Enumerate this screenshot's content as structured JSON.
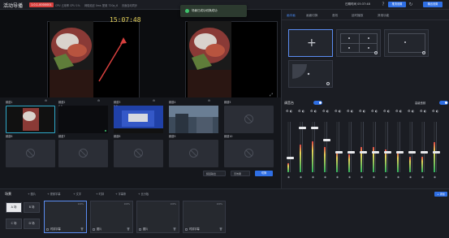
{
  "topbar": {
    "app_title": "活动导播",
    "version": "1.0.1-0000001",
    "cpu": "CPU 占用率 CPU 1%",
    "net": "网络延迟 0ms",
    "res": "配置 720p_6",
    "sync": "页面自动同步",
    "clock": "日期时间 05:37:48",
    "settings_btn": "推流设置",
    "output_btn": "输出设置"
  },
  "toast": {
    "text": "场景已成功切换成功"
  },
  "preview": {
    "clock": "15:07:48",
    "pvw_label": "PVW 预监",
    "pgm_label": "PGM 输出",
    "accent_pvw": "#4a8cf7",
    "accent_pgm": "#e04646"
  },
  "sources": {
    "items": [
      {
        "label": "频道1",
        "meta": "1 ✕",
        "status": "live"
      },
      {
        "label": "频道2",
        "meta": "2 ✕",
        "status": "live"
      },
      {
        "label": "频道3",
        "meta": "3 ✕",
        "status": "live"
      },
      {
        "label": "频道4",
        "meta": "4 ✕",
        "status": "live"
      },
      {
        "label": "频道5",
        "meta": "",
        "status": "empty"
      },
      {
        "label": "频道6",
        "meta": "",
        "status": "empty"
      },
      {
        "label": "频道7",
        "meta": "",
        "status": "empty"
      },
      {
        "label": "频道8",
        "meta": "",
        "status": "empty"
      },
      {
        "label": "频道9",
        "meta": "",
        "status": "empty"
      },
      {
        "label": "频道10",
        "meta": "",
        "status": "empty"
      }
    ],
    "select_a": "频道输出",
    "select_b": "无效果",
    "switch_btn": "切换"
  },
  "right_panel": {
    "tabs": [
      "画中画",
      "画面切换",
      "音效",
      "延时播放",
      "其他功能"
    ]
  },
  "mixer": {
    "title": "调音台",
    "right_label": "高级音频",
    "channels": [
      {
        "level": 0.18,
        "knob": 0.72
      },
      {
        "level": 0.55,
        "knob": 0.1
      },
      {
        "level": 0.62,
        "knob": 0.1
      },
      {
        "level": 0.5,
        "knob": 0.35
      },
      {
        "level": 0.4,
        "knob": 0.6
      },
      {
        "level": 0.35,
        "knob": 0.6
      },
      {
        "level": 0.5,
        "knob": 0.6
      },
      {
        "level": 0.5,
        "knob": 0.6
      },
      {
        "level": 0.45,
        "knob": 0.6
      },
      {
        "level": 0.4,
        "knob": 0.6
      },
      {
        "level": 0.3,
        "knob": 0.6
      },
      {
        "level": 0.3,
        "knob": 0.6
      },
      {
        "level": 0.6,
        "knob": 0.6
      }
    ]
  },
  "scene": {
    "title": "场景",
    "toolbar": [
      "+ 图片",
      "+ 视频字幕",
      "+ 文字",
      "+ 时钟",
      "+ 字幕条",
      "+ 比分板"
    ],
    "tiles": [
      "A 场",
      "B 场",
      "C 场",
      "D 场"
    ],
    "cards": [
      {
        "name": "时钟字幕",
        "pct": "100%"
      },
      {
        "name": "图片",
        "pct": "100%"
      },
      {
        "name": "图片",
        "pct": "100%"
      },
      {
        "name": "时钟字幕",
        "pct": "100%"
      }
    ],
    "add_btn": "+ 添加"
  }
}
